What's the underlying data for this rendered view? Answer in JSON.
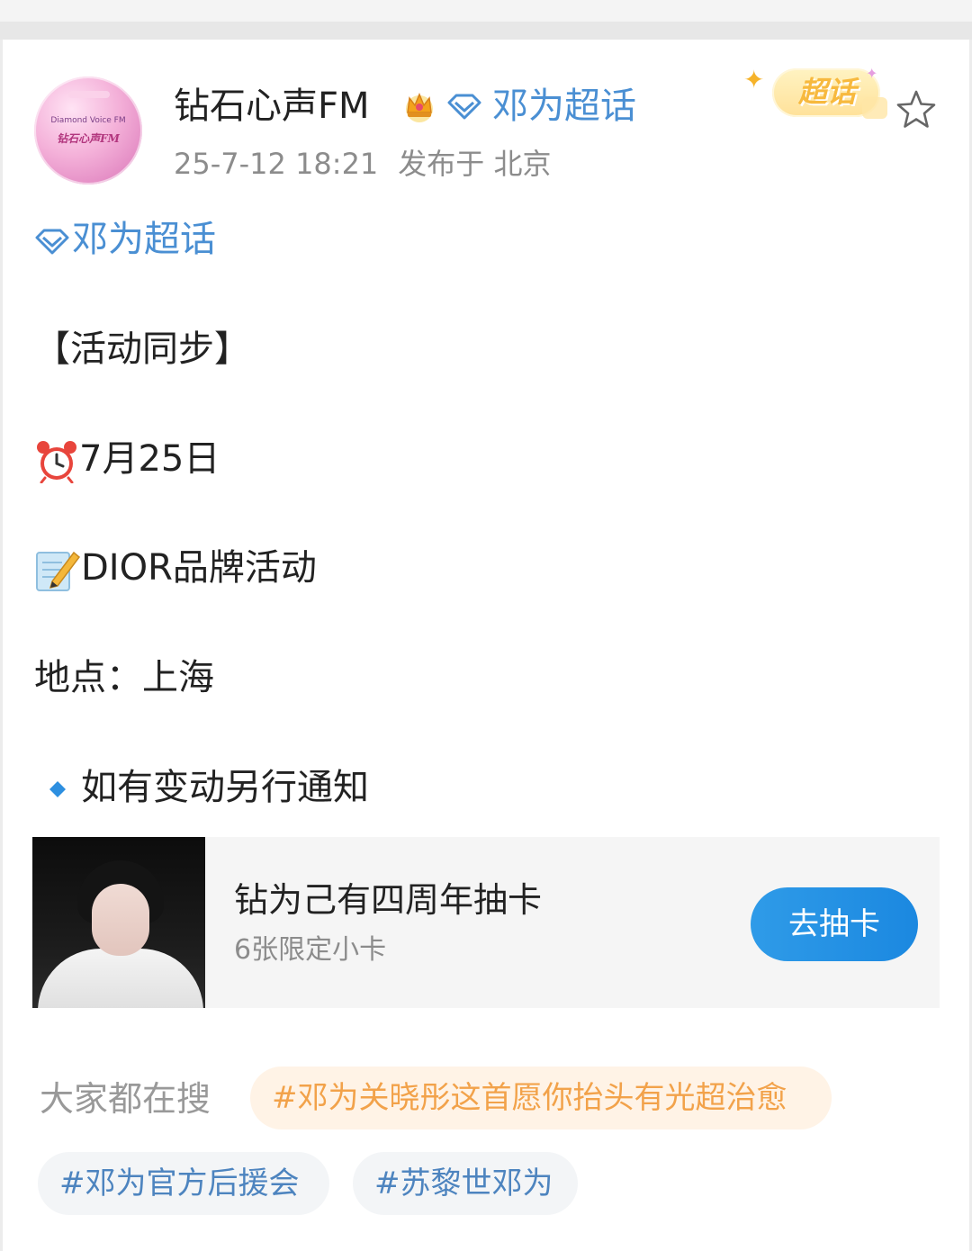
{
  "post": {
    "username": "钻石心声FM",
    "topic_link": "邓为超话",
    "time": "25-7-12 18:21",
    "location": "发布于 北京",
    "badge": "超话",
    "avatar_text_small": "Diamond Voice FM",
    "avatar_logo": "钻石心声FM"
  },
  "content": {
    "topic": "邓为超话",
    "heading": "【活动同步】",
    "date": "7月25日",
    "event": "DIOR品牌活动",
    "place": "地点：上海",
    "notice": "如有变动另行通知"
  },
  "card": {
    "title": "钻为己有四周年抽卡",
    "subtitle": "6张限定小卡",
    "button": "去抽卡"
  },
  "hot_search": {
    "label": "大家都在搜",
    "tags": [
      "#邓为关晓彤这首愿你抬头有光超治愈",
      "#邓为官方后援会",
      "#苏黎世邓为"
    ]
  },
  "icons": {
    "crown": "crown-icon",
    "diamond": "diamond-icon",
    "alarm": "alarm-clock-icon",
    "memo": "memo-icon",
    "bullet": "blue-diamond-icon",
    "star": "star-icon"
  },
  "colors": {
    "link_blue": "#4a8fd3",
    "button_blue": "#1b88e0",
    "hot_orange": "#f2a24a"
  }
}
